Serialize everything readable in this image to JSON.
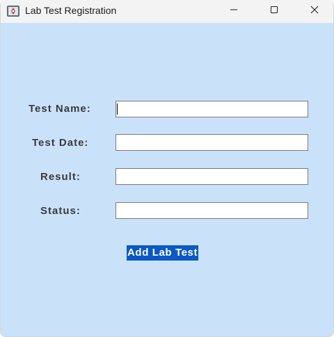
{
  "window": {
    "title": "Lab Test Registration",
    "icon": "java-app-icon",
    "controls": {
      "minimize_icon": "minimize-icon",
      "maximize_icon": "maximize-icon",
      "close_icon": "close-icon"
    }
  },
  "form": {
    "fields": [
      {
        "label": "Test Name:",
        "value": "",
        "placeholder": "",
        "focused": true
      },
      {
        "label": "Test Date:",
        "value": "",
        "placeholder": ""
      },
      {
        "label": "Result:",
        "value": "",
        "placeholder": ""
      },
      {
        "label": "Status:",
        "value": "",
        "placeholder": ""
      }
    ],
    "submit_label": "Add Lab Test"
  },
  "colors": {
    "background": "#c9e2fa",
    "titlebar": "#f3f3f3",
    "button_bg": "#0a59c4",
    "button_text": "#ffffff",
    "label_text": "#3a3a3a"
  }
}
